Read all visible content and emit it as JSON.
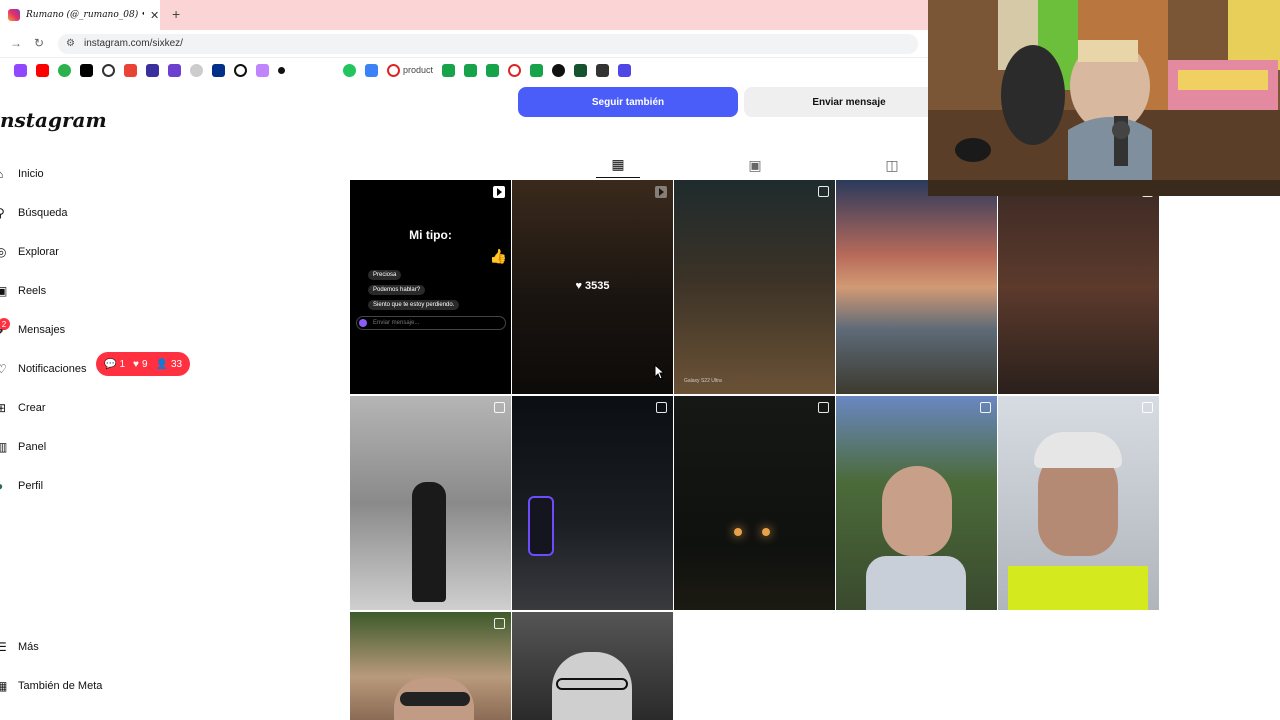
{
  "browser": {
    "tab_title": "Rumano (@_rumano_08) • Fo",
    "tab_close": "✕",
    "new_tab": "+",
    "back": "←",
    "forward": "→",
    "reload": "↻",
    "url": "instagram.com/sixkez/",
    "bookmark_text": "product"
  },
  "instagram": {
    "logo": "nstagram",
    "nav": [
      {
        "label": "Inicio",
        "icon": "home-icon"
      },
      {
        "label": "Búsqueda",
        "icon": "search-icon"
      },
      {
        "label": "Explorar",
        "icon": "compass-icon"
      },
      {
        "label": "Reels",
        "icon": "reels-icon"
      },
      {
        "label": "Mensajes",
        "icon": "messenger-icon",
        "badge": "2"
      },
      {
        "label": "Notificaciones",
        "icon": "heart-icon"
      },
      {
        "label": "Crear",
        "icon": "plus-icon"
      },
      {
        "label": "Panel",
        "icon": "dashboard-icon"
      },
      {
        "label": "Perfil",
        "icon": "avatar-icon"
      },
      {
        "label": "Más",
        "icon": "menu-icon"
      },
      {
        "label": "También de Meta",
        "icon": "meta-icon"
      }
    ],
    "notifications_pill": {
      "comments": "1",
      "likes": "9",
      "follows": "33"
    },
    "follow_button": "Seguir también",
    "message_button": "Enviar mensaje",
    "tabs": [
      "posts-grid-icon",
      "reels-icon",
      "tagged-icon"
    ],
    "post1": {
      "title": "Mi tipo:",
      "messages": [
        "Preciosa",
        "Podemos hablar?",
        "Siento que te estoy perdiendo."
      ],
      "input_placeholder": "Enviar mensaje..."
    },
    "post2": {
      "likes": "3535"
    },
    "post3": {
      "watermark": "Galaxy S22 Ultra"
    }
  },
  "colors": {
    "follow_blue": "#4a5df9",
    "badge_red": "#ff3040",
    "tab_bar_pink": "#fbd5d5"
  }
}
